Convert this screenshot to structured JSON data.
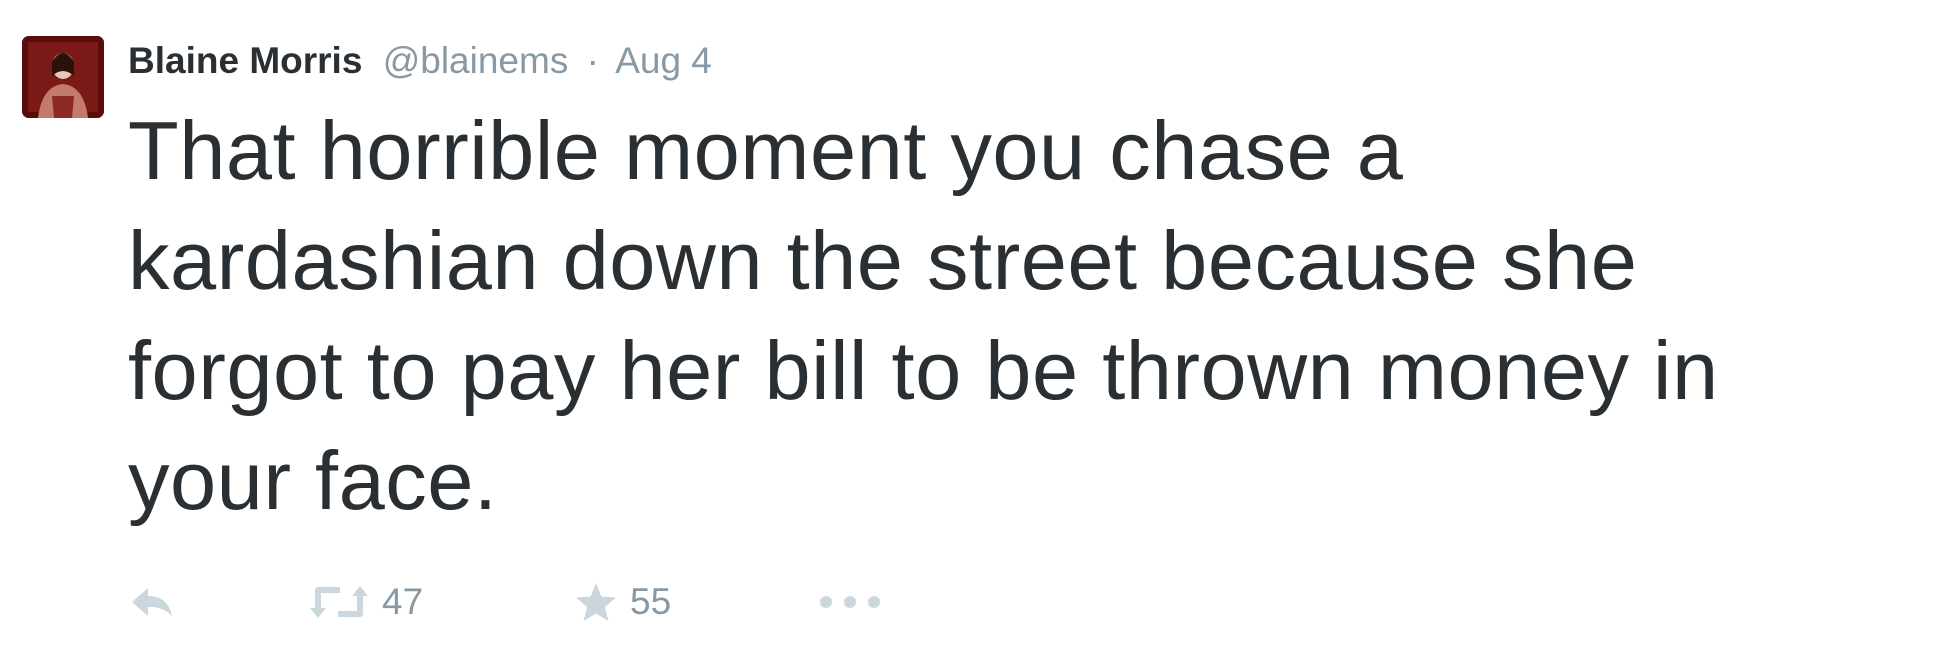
{
  "tweet": {
    "author": {
      "name": "Blaine Morris",
      "handle": "@blainems",
      "avatar_icon": "profile-photo"
    },
    "separator": "·",
    "date": "Aug 4",
    "text": "That horrible moment you chase a\nkardashian down the street because she\nforgot to pay her bill to be thrown money in\nyour face.",
    "actions": {
      "reply": {
        "icon": "reply-icon"
      },
      "retweet": {
        "icon": "retweet-icon",
        "count": "47"
      },
      "favorite": {
        "icon": "star-icon",
        "count": "55"
      },
      "more": {
        "icon": "more-icon"
      }
    }
  },
  "colors": {
    "text": "#292f33",
    "muted": "#8899a6",
    "icon": "#ccd6dd",
    "avatar_bg": "#6e1010"
  }
}
